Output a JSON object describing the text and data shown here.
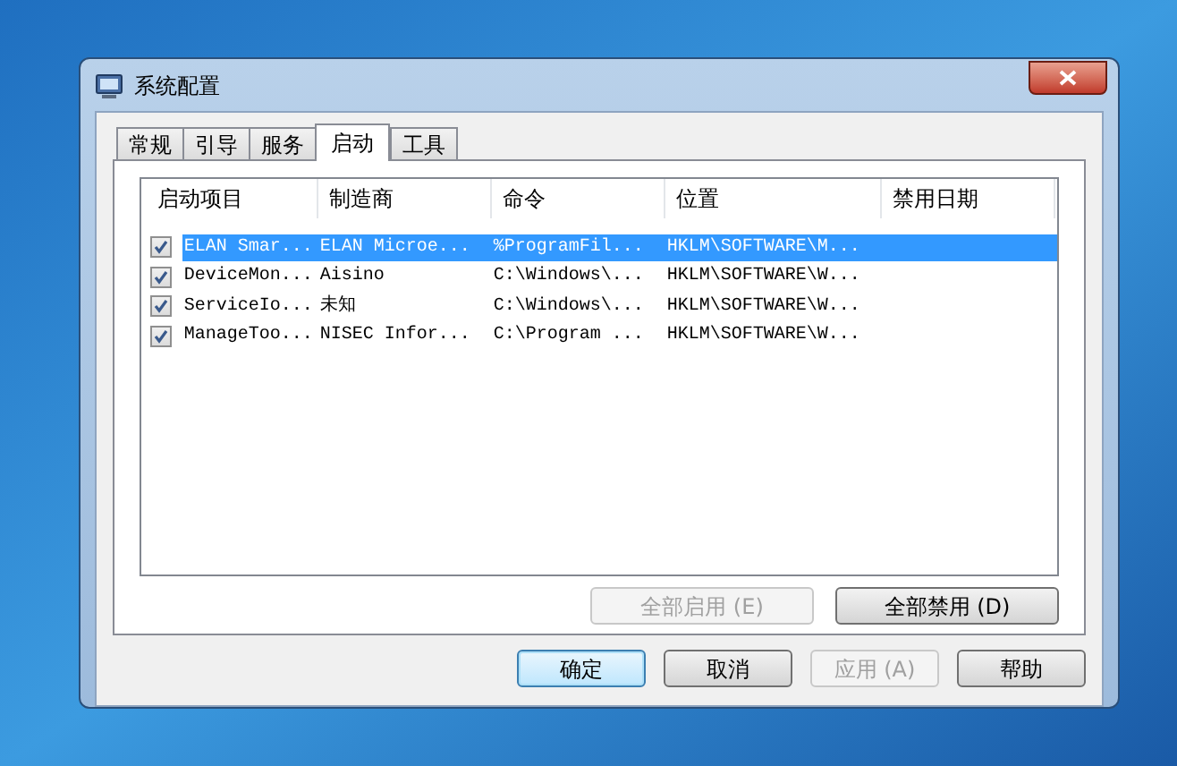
{
  "window": {
    "title": "系统配置"
  },
  "tabs": [
    {
      "label": "常规",
      "selected": false
    },
    {
      "label": "引导",
      "selected": false
    },
    {
      "label": "服务",
      "selected": false
    },
    {
      "label": "启动",
      "selected": true
    },
    {
      "label": "工具",
      "selected": false
    }
  ],
  "table": {
    "columns": [
      "启动项目",
      "制造商",
      "命令",
      "位置",
      "禁用日期"
    ],
    "rows": [
      {
        "checked": true,
        "selected": true,
        "cells": [
          "ELAN Smar...",
          "ELAN Microe...",
          "%ProgramFil...",
          "HKLM\\SOFTWARE\\M..."
        ]
      },
      {
        "checked": true,
        "selected": false,
        "cells": [
          "DeviceMon...",
          "Aisino",
          "C:\\Windows\\...",
          "HKLM\\SOFTWARE\\W..."
        ]
      },
      {
        "checked": true,
        "selected": false,
        "cells": [
          "ServiceIo...",
          "未知",
          "C:\\Windows\\...",
          "HKLM\\SOFTWARE\\W..."
        ]
      },
      {
        "checked": true,
        "selected": false,
        "cells": [
          "ManageToo...",
          "NISEC Infor...",
          "C:\\Program ...",
          "HKLM\\SOFTWARE\\W..."
        ]
      }
    ]
  },
  "panel_buttons": [
    {
      "label": "全部启用 (E)",
      "disabled": true
    },
    {
      "label": "全部禁用 (D)",
      "disabled": false
    }
  ],
  "dialog_buttons": [
    {
      "label": "确定",
      "disabled": false,
      "default": true
    },
    {
      "label": "取消",
      "disabled": false,
      "default": false
    },
    {
      "label": "应用 (A)",
      "disabled": true,
      "default": false
    },
    {
      "label": "帮助",
      "disabled": false,
      "default": false
    }
  ]
}
